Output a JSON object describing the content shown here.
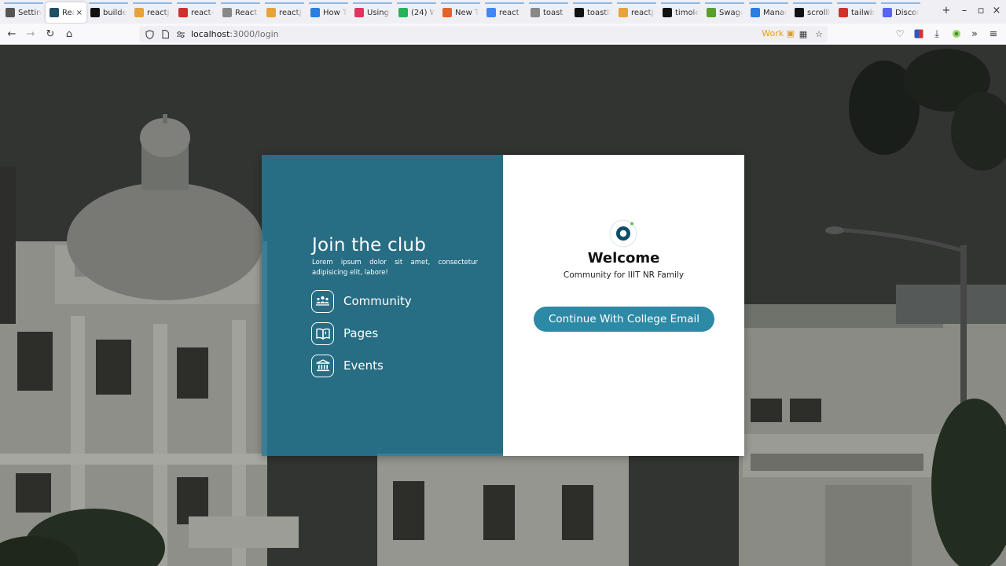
{
  "browser": {
    "tabs": [
      {
        "label": "Settings",
        "icon": "gear-icon",
        "color": "#555555"
      },
      {
        "label": "React",
        "icon": "react-tab-icon",
        "color": "#1e4f66",
        "active": true
      },
      {
        "label": "builder",
        "icon": "github-icon",
        "color": "#111111"
      },
      {
        "label": "reactjs",
        "icon": "reactjs-tab-icon",
        "color": "#e7a23a"
      },
      {
        "label": "react-",
        "icon": "red-tab-icon",
        "color": "#d0312d"
      },
      {
        "label": "React",
        "icon": "toast-tab-icon",
        "color": "#888888"
      },
      {
        "label": "reactjs",
        "icon": "reactjs-tab-icon",
        "color": "#e7a23a"
      },
      {
        "label": "How T",
        "icon": "howto-tab-icon",
        "color": "#2a7de1"
      },
      {
        "label": "Using",
        "icon": "using-tab-icon",
        "color": "#e03561"
      },
      {
        "label": "(24) W",
        "icon": "whatsapp-icon",
        "color": "#25b25a"
      },
      {
        "label": "New T",
        "icon": "firefox-icon",
        "color": "#e2642a"
      },
      {
        "label": "react",
        "icon": "google-icon",
        "color": "#4285f4"
      },
      {
        "label": "toast",
        "icon": "toast-tab-icon",
        "color": "#888888"
      },
      {
        "label": "toastif",
        "icon": "github-icon",
        "color": "#111111"
      },
      {
        "label": "reactjs",
        "icon": "reactjs-tab-icon",
        "color": "#e7a23a"
      },
      {
        "label": "timole",
        "icon": "github-icon",
        "color": "#111111"
      },
      {
        "label": "Swagg",
        "icon": "swagger-icon",
        "color": "#5aa028"
      },
      {
        "label": "Manag",
        "icon": "vscode-icon",
        "color": "#2a7de1"
      },
      {
        "label": "scrolll",
        "icon": "scroll-tab-icon",
        "color": "#111111"
      },
      {
        "label": "tailwin",
        "icon": "red-tab-icon",
        "color": "#d0312d"
      },
      {
        "label": "Discor",
        "icon": "discord-icon",
        "color": "#5865f2"
      }
    ],
    "active_tab_close": "×",
    "new_tab": "+",
    "url_host": "localhost",
    "url_path": ":3000/login",
    "container_label": "Work"
  },
  "page": {
    "left": {
      "title": "Join the club",
      "description": "Lorem ipsum dolor sit amet, consectetur adipisicing elit, labore!",
      "features": [
        {
          "label": "Community",
          "icon": "community-icon"
        },
        {
          "label": "Pages",
          "icon": "book-icon"
        },
        {
          "label": "Events",
          "icon": "institution-icon"
        }
      ]
    },
    "right": {
      "logo_icon": "club-logo-icon",
      "welcome": "Welcome",
      "subtitle": "Community for IIIT NR Family",
      "cta_label": "Continue With College Email"
    }
  },
  "colors": {
    "panel": "#247a96",
    "cta": "#2d8aa7",
    "card_right": "#ffffff"
  }
}
